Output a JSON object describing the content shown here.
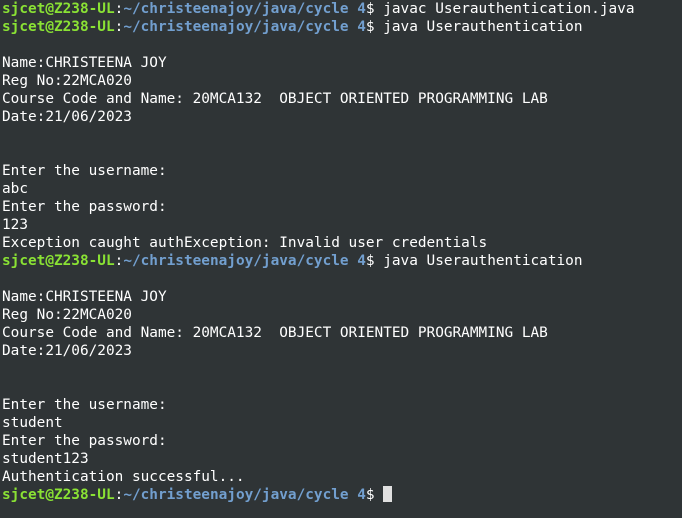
{
  "prompt": {
    "user_host": "sjcet@Z238-UL",
    "separator": ":",
    "path": "~/christeenajoy/java/cycle 4",
    "symbol": "$ "
  },
  "lines": [
    {
      "type": "prompt",
      "command": "javac Userauthentication.java"
    },
    {
      "type": "prompt",
      "command": "java Userauthentication"
    },
    {
      "type": "text",
      "text": ""
    },
    {
      "type": "text",
      "text": "Name:CHRISTEENA JOY"
    },
    {
      "type": "text",
      "text": "Reg No:22MCA020"
    },
    {
      "type": "text",
      "text": "Course Code and Name: 20MCA132  OBJECT ORIENTED PROGRAMMING LAB"
    },
    {
      "type": "text",
      "text": "Date:21/06/2023"
    },
    {
      "type": "text",
      "text": ""
    },
    {
      "type": "text",
      "text": ""
    },
    {
      "type": "text",
      "text": "Enter the username:"
    },
    {
      "type": "text",
      "text": "abc"
    },
    {
      "type": "text",
      "text": "Enter the password:"
    },
    {
      "type": "text",
      "text": "123"
    },
    {
      "type": "text",
      "text": "Exception caught authException: Invalid user credentials"
    },
    {
      "type": "prompt",
      "command": "java Userauthentication"
    },
    {
      "type": "text",
      "text": ""
    },
    {
      "type": "text",
      "text": "Name:CHRISTEENA JOY"
    },
    {
      "type": "text",
      "text": "Reg No:22MCA020"
    },
    {
      "type": "text",
      "text": "Course Code and Name: 20MCA132  OBJECT ORIENTED PROGRAMMING LAB"
    },
    {
      "type": "text",
      "text": "Date:21/06/2023"
    },
    {
      "type": "text",
      "text": ""
    },
    {
      "type": "text",
      "text": ""
    },
    {
      "type": "text",
      "text": "Enter the username:"
    },
    {
      "type": "text",
      "text": "student"
    },
    {
      "type": "text",
      "text": "Enter the password:"
    },
    {
      "type": "text",
      "text": "student123"
    },
    {
      "type": "text",
      "text": "Authentication successful..."
    },
    {
      "type": "prompt",
      "command": "",
      "cursor": true
    }
  ],
  "colors": {
    "background": "#2f3436",
    "user_host": "#8ae234",
    "path": "#729fcf",
    "text": "#ffffff",
    "cursor": "#e0e0e0"
  }
}
